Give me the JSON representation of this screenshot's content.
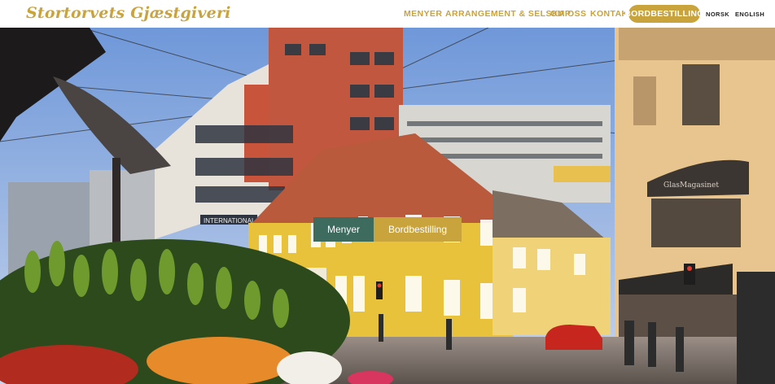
{
  "header": {
    "logo_text": "Stortorvets Gjæstgiveri",
    "nav": [
      "MENYER",
      "ARRANGEMENT & SELSKAP",
      "OM OSS",
      "KONTAKT"
    ],
    "cta_label": "BORDBESTILLING",
    "languages": [
      "NORSK",
      "ENGLISH"
    ]
  },
  "hero": {
    "primary_button": "Menyer",
    "secondary_button": "Bordbestilling",
    "shop_sign": "GlasMagasinet",
    "building_sign": "INTERNATIONAL"
  },
  "colors": {
    "brand_gold": "#c9a33b",
    "menu_green": "#3d6b5d",
    "facade_yellow": "#e9c23b"
  }
}
